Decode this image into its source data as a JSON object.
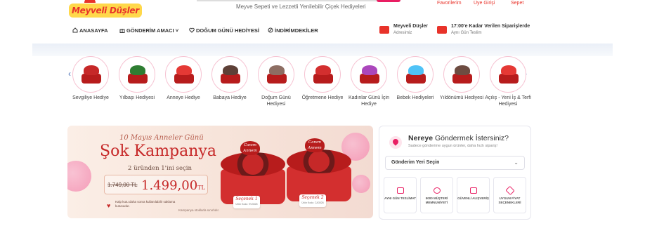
{
  "header": {
    "logo_text": "Meyveli Düşler",
    "tagline": "Meyve Sepeti ve Lezzetli Yenilebilir Çiçek Hediyeleri",
    "links": {
      "favorites": "Favorilerim",
      "login": "Üye Girişi",
      "cart": "Sepet"
    }
  },
  "nav": {
    "items": [
      "ANASAYFA",
      "GÖNDERİM AMACI",
      "DOĞUM GÜNÜ HEDİYESİ",
      "İNDİRİMDEKİLER"
    ],
    "address": {
      "title": "Meyveli Düşler",
      "subtitle": "Adresimiz"
    },
    "delivery": {
      "title": "17:00'e Kadar Verilen Siparişlerde",
      "subtitle": "Aynı Gün Teslim"
    }
  },
  "categories": [
    {
      "label": "Sevgiliye Hediye",
      "icon": "heart-cake-icon",
      "top": "#c62828"
    },
    {
      "label": "Yılbaşı Hediyesi",
      "icon": "christmas-tree-icon",
      "top": "#2e7d32"
    },
    {
      "label": "Anneye Hediye",
      "icon": "flower-cake-icon",
      "top": "#e53935"
    },
    {
      "label": "Babaya Hediye",
      "icon": "chocolate-cake-icon",
      "top": "#5d4037"
    },
    {
      "label": "Doğum Günü Hediyesi",
      "icon": "birthday-cake-icon",
      "top": "#8d6e63"
    },
    {
      "label": "Öğretmene Hediye",
      "icon": "heart-box-icon",
      "top": "#d32f2f"
    },
    {
      "label": "Kadınlar Günü İçin Hediye",
      "icon": "number-eight-cake-icon",
      "top": "#ab47bc"
    },
    {
      "label": "Bebek Hediyeleri",
      "icon": "teddy-bear-icon",
      "top": "#4fc3f7"
    },
    {
      "label": "Yıldönümü Hediyesi",
      "icon": "fruit-tower-icon",
      "top": "#6d4c41"
    },
    {
      "label": "Açılış - Yeni İş & Terfi Hediyesi",
      "icon": "fruit-bouquet-icon",
      "top": "#e53935"
    }
  ],
  "banner": {
    "subtitle": "10 Mayıs Anneler Günü",
    "title": "Şok Kampanya",
    "offer": "2 üründen 1'ini seçin",
    "old_price": "1.749,00 TL",
    "new_price": "1.499,00",
    "currency": "TL",
    "note": "Kalp kutu daha sonra kullanılabilir saklama kutusudur.",
    "fine_print": "Kampanya stoklarla sınırlıdır.",
    "option1": {
      "name": "Seçenek 1",
      "code": "Ürün Kodu: SV3026",
      "tag": "Canım Annem"
    },
    "option2": {
      "name": "Seçenek 2",
      "code": "Ürün Kodu: CA3026",
      "tag": "Canım Annem"
    }
  },
  "delivery_panel": {
    "title_bold": "Nereye",
    "title_rest": " Göndermek İstersiniz?",
    "subtitle": "Sadece gönderime uygun ürünler, daha hızlı sipariş!",
    "select_value": "Gönderim Yeri Seçin",
    "features": [
      {
        "label": "AYNI GÜN TESLİMAT",
        "icon": "truck-icon"
      },
      {
        "label": "5000 MÜŞTERİ MEMNUNİYETİ",
        "icon": "smile-icon"
      },
      {
        "label": "GÜVENLİ ALIŞVERİŞ",
        "icon": "lock-icon"
      },
      {
        "label": "UYGUN FİYAT SEÇENEKLERİ",
        "icon": "tag-icon"
      }
    ]
  },
  "colors": {
    "brand": "#e8332a",
    "accent": "#e91e63",
    "banner_title": "#c62828"
  }
}
